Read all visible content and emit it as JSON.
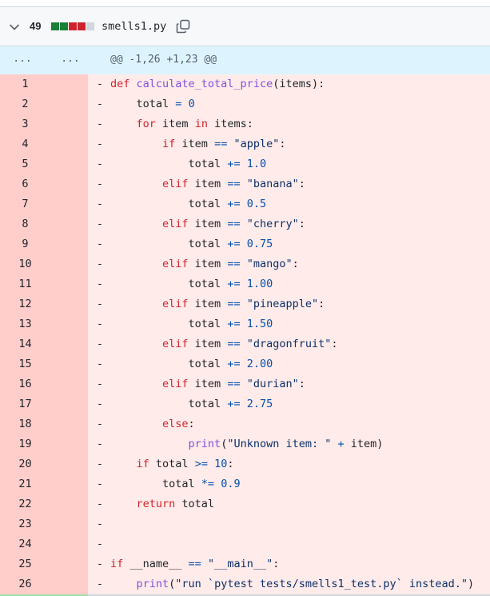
{
  "file": {
    "changes_count": "49",
    "filename": "smells1.py",
    "diffstat_colors": [
      "#1a7f37",
      "#1a7f37",
      "#cf222e",
      "#cf222e",
      "#d0d7de"
    ],
    "icons": {
      "collapse": "chevron-down-icon",
      "copy": "copy-icon"
    }
  },
  "hunk": {
    "ellipsis_old": "...",
    "ellipsis_new": "...",
    "header": "@@ -1,26 +1,23 @@"
  },
  "lines": [
    {
      "num": "1",
      "sign": "-",
      "tokens": [
        [
          "k",
          "def "
        ],
        [
          "f",
          "calculate_total_price"
        ],
        [
          "v",
          "(items):"
        ]
      ]
    },
    {
      "num": "2",
      "sign": "-",
      "tokens": [
        [
          "v",
          "    total "
        ],
        [
          "o",
          "="
        ],
        [
          "v",
          " "
        ],
        [
          "n",
          "0"
        ]
      ]
    },
    {
      "num": "3",
      "sign": "-",
      "tokens": [
        [
          "v",
          "    "
        ],
        [
          "k",
          "for"
        ],
        [
          "v",
          " item "
        ],
        [
          "k",
          "in"
        ],
        [
          "v",
          " items:"
        ]
      ]
    },
    {
      "num": "4",
      "sign": "-",
      "tokens": [
        [
          "v",
          "        "
        ],
        [
          "k",
          "if"
        ],
        [
          "v",
          " item "
        ],
        [
          "o",
          "=="
        ],
        [
          "v",
          " "
        ],
        [
          "s",
          "\"apple\""
        ],
        [
          "v",
          ":"
        ]
      ]
    },
    {
      "num": "5",
      "sign": "-",
      "tokens": [
        [
          "v",
          "            total "
        ],
        [
          "o",
          "+="
        ],
        [
          "v",
          " "
        ],
        [
          "n",
          "1.0"
        ]
      ]
    },
    {
      "num": "6",
      "sign": "-",
      "tokens": [
        [
          "v",
          "        "
        ],
        [
          "k",
          "elif"
        ],
        [
          "v",
          " item "
        ],
        [
          "o",
          "=="
        ],
        [
          "v",
          " "
        ],
        [
          "s",
          "\"banana\""
        ],
        [
          "v",
          ":"
        ]
      ]
    },
    {
      "num": "7",
      "sign": "-",
      "tokens": [
        [
          "v",
          "            total "
        ],
        [
          "o",
          "+="
        ],
        [
          "v",
          " "
        ],
        [
          "n",
          "0.5"
        ]
      ]
    },
    {
      "num": "8",
      "sign": "-",
      "tokens": [
        [
          "v",
          "        "
        ],
        [
          "k",
          "elif"
        ],
        [
          "v",
          " item "
        ],
        [
          "o",
          "=="
        ],
        [
          "v",
          " "
        ],
        [
          "s",
          "\"cherry\""
        ],
        [
          "v",
          ":"
        ]
      ]
    },
    {
      "num": "9",
      "sign": "-",
      "tokens": [
        [
          "v",
          "            total "
        ],
        [
          "o",
          "+="
        ],
        [
          "v",
          " "
        ],
        [
          "n",
          "0.75"
        ]
      ]
    },
    {
      "num": "10",
      "sign": "-",
      "tokens": [
        [
          "v",
          "        "
        ],
        [
          "k",
          "elif"
        ],
        [
          "v",
          " item "
        ],
        [
          "o",
          "=="
        ],
        [
          "v",
          " "
        ],
        [
          "s",
          "\"mango\""
        ],
        [
          "v",
          ":"
        ]
      ]
    },
    {
      "num": "11",
      "sign": "-",
      "tokens": [
        [
          "v",
          "            total "
        ],
        [
          "o",
          "+="
        ],
        [
          "v",
          " "
        ],
        [
          "n",
          "1.00"
        ]
      ]
    },
    {
      "num": "12",
      "sign": "-",
      "tokens": [
        [
          "v",
          "        "
        ],
        [
          "k",
          "elif"
        ],
        [
          "v",
          " item "
        ],
        [
          "o",
          "=="
        ],
        [
          "v",
          " "
        ],
        [
          "s",
          "\"pineapple\""
        ],
        [
          "v",
          ":"
        ]
      ]
    },
    {
      "num": "13",
      "sign": "-",
      "tokens": [
        [
          "v",
          "            total "
        ],
        [
          "o",
          "+="
        ],
        [
          "v",
          " "
        ],
        [
          "n",
          "1.50"
        ]
      ]
    },
    {
      "num": "14",
      "sign": "-",
      "tokens": [
        [
          "v",
          "        "
        ],
        [
          "k",
          "elif"
        ],
        [
          "v",
          " item "
        ],
        [
          "o",
          "=="
        ],
        [
          "v",
          " "
        ],
        [
          "s",
          "\"dragonfruit\""
        ],
        [
          "v",
          ":"
        ]
      ]
    },
    {
      "num": "15",
      "sign": "-",
      "tokens": [
        [
          "v",
          "            total "
        ],
        [
          "o",
          "+="
        ],
        [
          "v",
          " "
        ],
        [
          "n",
          "2.00"
        ]
      ]
    },
    {
      "num": "16",
      "sign": "-",
      "tokens": [
        [
          "v",
          "        "
        ],
        [
          "k",
          "elif"
        ],
        [
          "v",
          " item "
        ],
        [
          "o",
          "=="
        ],
        [
          "v",
          " "
        ],
        [
          "s",
          "\"durian\""
        ],
        [
          "v",
          ":"
        ]
      ]
    },
    {
      "num": "17",
      "sign": "-",
      "tokens": [
        [
          "v",
          "            total "
        ],
        [
          "o",
          "+="
        ],
        [
          "v",
          " "
        ],
        [
          "n",
          "2.75"
        ]
      ]
    },
    {
      "num": "18",
      "sign": "-",
      "tokens": [
        [
          "v",
          "        "
        ],
        [
          "k",
          "else"
        ],
        [
          "v",
          ":"
        ]
      ]
    },
    {
      "num": "19",
      "sign": "-",
      "tokens": [
        [
          "v",
          "            "
        ],
        [
          "f",
          "print"
        ],
        [
          "v",
          "("
        ],
        [
          "s",
          "\"Unknown item: \""
        ],
        [
          "v",
          " "
        ],
        [
          "o",
          "+"
        ],
        [
          "v",
          " item)"
        ]
      ]
    },
    {
      "num": "20",
      "sign": "-",
      "tokens": [
        [
          "v",
          "    "
        ],
        [
          "k",
          "if"
        ],
        [
          "v",
          " total "
        ],
        [
          "o",
          "&gt;="
        ],
        [
          "v",
          " "
        ],
        [
          "n",
          "10"
        ],
        [
          "v",
          ":"
        ]
      ]
    },
    {
      "num": "21",
      "sign": "-",
      "tokens": [
        [
          "v",
          "        total "
        ],
        [
          "o",
          "*="
        ],
        [
          "v",
          " "
        ],
        [
          "n",
          "0.9"
        ]
      ]
    },
    {
      "num": "22",
      "sign": "-",
      "tokens": [
        [
          "v",
          "    "
        ],
        [
          "k",
          "return"
        ],
        [
          "v",
          " total"
        ]
      ]
    },
    {
      "num": "23",
      "sign": "-",
      "tokens": []
    },
    {
      "num": "24",
      "sign": "-",
      "tokens": []
    },
    {
      "num": "25",
      "sign": "-",
      "tokens": [
        [
          "k",
          "if"
        ],
        [
          "v",
          " __name__ "
        ],
        [
          "o",
          "=="
        ],
        [
          "v",
          " "
        ],
        [
          "s",
          "\"__main__\""
        ],
        [
          "v",
          ":"
        ]
      ]
    },
    {
      "num": "26",
      "sign": "-",
      "tokens": [
        [
          "v",
          "    "
        ],
        [
          "f",
          "print"
        ],
        [
          "v",
          "("
        ],
        [
          "s",
          "\"run `pytest tests/smells1_test.py` instead.\""
        ],
        [
          "v",
          ")"
        ]
      ]
    }
  ]
}
